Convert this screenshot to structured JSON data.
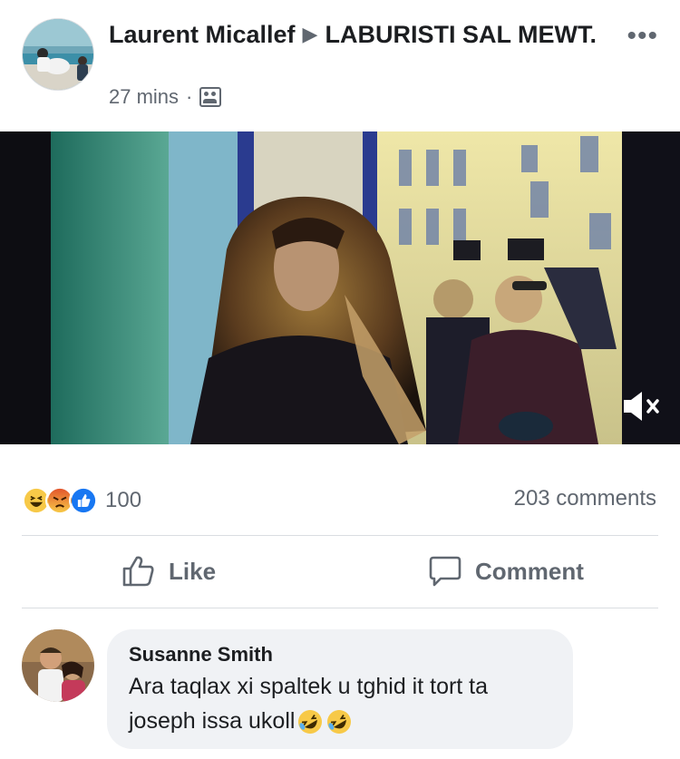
{
  "post": {
    "author": "Laurent Micallef",
    "target_group": "LABURISTI SAL MEWT.",
    "time": "27 mins",
    "separator": "·",
    "audience_icon": "group-icon",
    "more_icon": "more-dots-icon",
    "more_label": "•••"
  },
  "video": {
    "muted": true,
    "mute_icon": "speaker-muted-icon"
  },
  "stats": {
    "reactions": [
      "haha-reaction",
      "angry-reaction",
      "like-reaction"
    ],
    "reaction_count": "100",
    "comments_count": "203 comments"
  },
  "actions": {
    "like_label": "Like",
    "comment_label": "Comment"
  },
  "comment": {
    "author": "Susanne Smith",
    "line1": "Ara taqlax xi spaltek u tghid it tort ta",
    "line2": "joseph issa ukoll",
    "emojis": [
      "rolling-on-floor-laughing-emoji",
      "rolling-on-floor-laughing-emoji"
    ]
  },
  "colors": {
    "secondary_text": "#606770",
    "bubble": "#f0f2f5",
    "like_blue": "#1877f2",
    "divider": "#dadde1"
  }
}
